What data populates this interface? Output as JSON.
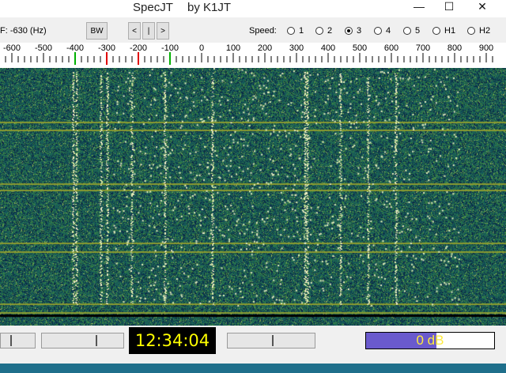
{
  "window": {
    "title": "SpecJT",
    "author": "by K1JT",
    "minimize_icon": "minimize-icon",
    "maximize_icon": "maximize-icon",
    "close_icon": "close-icon"
  },
  "controls": {
    "df_label": "F:  -630  (Hz)",
    "bw_button": "BW",
    "nav_buttons": [
      "<",
      "|",
      ">"
    ],
    "speed_label": "Speed:",
    "speed_options": [
      {
        "label": "1",
        "selected": false
      },
      {
        "label": "2",
        "selected": false
      },
      {
        "label": "3",
        "selected": true
      },
      {
        "label": "4",
        "selected": false
      },
      {
        "label": "5",
        "selected": false
      },
      {
        "label": "H1",
        "selected": false
      },
      {
        "label": "H2",
        "selected": false
      }
    ]
  },
  "scale": {
    "ticks": [
      "-600",
      "-500",
      "-400",
      "-300",
      "-200",
      "-100",
      "0",
      "100",
      "200",
      "300",
      "400",
      "500",
      "600",
      "700",
      "800",
      "900"
    ],
    "green_markers": [
      -400,
      -100
    ],
    "red_markers": [
      -300,
      -200
    ],
    "colors": {
      "green": "#00b000",
      "red": "#e00000"
    }
  },
  "waterfall": {
    "background": "#155e58"
  },
  "bottom": {
    "clock": "12:34:04",
    "level_text": "0 dB",
    "level_fraction": 0.55,
    "level_color": "#6a5acd"
  }
}
